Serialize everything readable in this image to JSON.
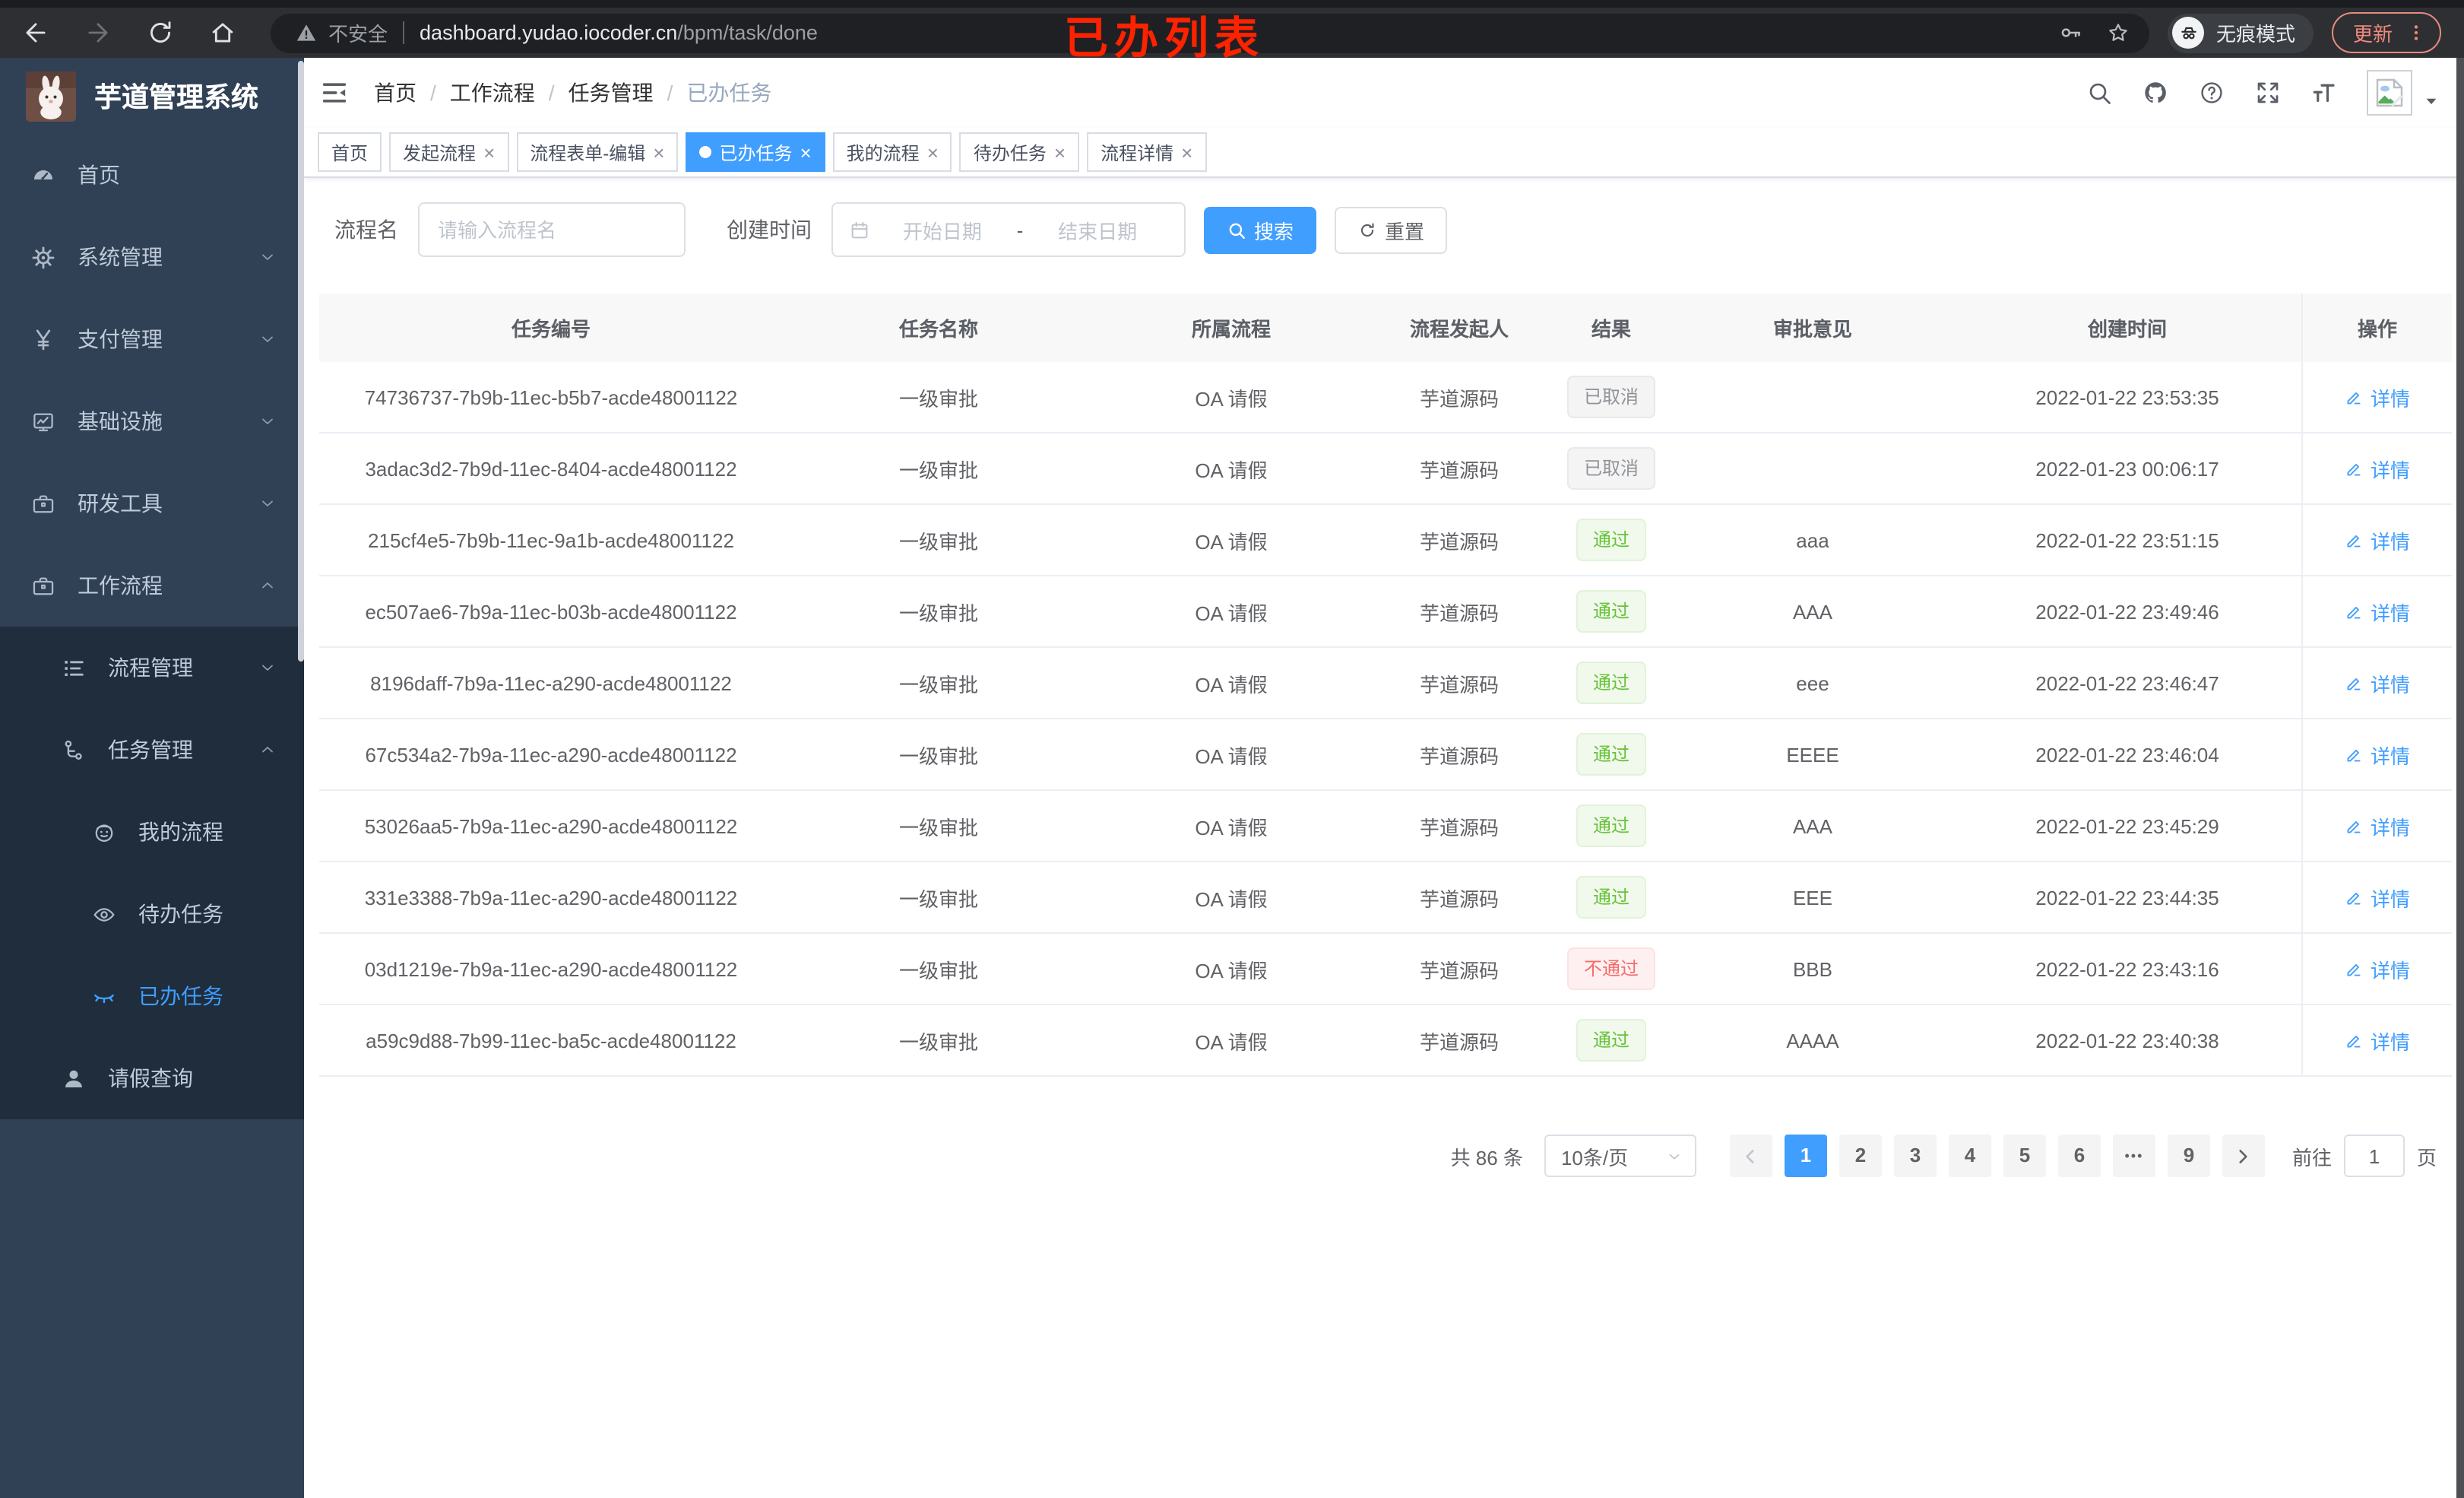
{
  "browser": {
    "nav_icons": [
      "back-icon",
      "forward-icon",
      "reload-icon",
      "home-icon"
    ],
    "security_label": "不安全",
    "url_host": "dashboard.yudao.iocoder.cn",
    "url_path": "/bpm/task/done",
    "incognito_label": "无痕模式",
    "update_label": "更新",
    "annotation": "已办列表"
  },
  "sidebar": {
    "title": "芋道管理系统",
    "items": [
      {
        "label": "首页",
        "icon": "dashboard-icon",
        "level": 1,
        "type": "item",
        "sub": false,
        "active": false
      },
      {
        "label": "系统管理",
        "icon": "gear-icon",
        "level": 1,
        "type": "group",
        "state": "collapsed",
        "sub": false,
        "active": false
      },
      {
        "label": "支付管理",
        "icon": "yen-icon",
        "level": 1,
        "type": "group",
        "state": "collapsed",
        "sub": false,
        "active": false
      },
      {
        "label": "基础设施",
        "icon": "monitor-icon",
        "level": 1,
        "type": "group",
        "state": "collapsed",
        "sub": false,
        "active": false
      },
      {
        "label": "研发工具",
        "icon": "briefcase-icon",
        "level": 1,
        "type": "group",
        "state": "collapsed",
        "sub": false,
        "active": false
      },
      {
        "label": "工作流程",
        "icon": "briefcase-icon",
        "level": 1,
        "type": "group",
        "state": "expanded",
        "sub": false,
        "active": false
      },
      {
        "label": "流程管理",
        "icon": "list-icon",
        "level": 2,
        "type": "group",
        "state": "collapsed",
        "sub": true,
        "active": false
      },
      {
        "label": "任务管理",
        "icon": "tree-icon",
        "level": 2,
        "type": "group",
        "state": "expanded",
        "sub": true,
        "active": false
      },
      {
        "label": "我的流程",
        "icon": "user-face-icon",
        "level": 3,
        "type": "item",
        "sub": true,
        "active": false
      },
      {
        "label": "待办任务",
        "icon": "eye-open-icon",
        "level": 3,
        "type": "item",
        "sub": true,
        "active": false
      },
      {
        "label": "已办任务",
        "icon": "eye-closed-icon",
        "level": 3,
        "type": "item",
        "sub": true,
        "active": true
      },
      {
        "label": "请假查询",
        "icon": "user-icon",
        "level": 2,
        "type": "item",
        "sub": true,
        "active": false
      }
    ]
  },
  "navbar": {
    "breadcrumb": [
      "首页",
      "工作流程",
      "任务管理",
      "已办任务"
    ],
    "separator": "/",
    "action_icons": [
      "search-icon",
      "github-icon",
      "question-icon",
      "fullscreen-icon",
      "font-size-icon"
    ]
  },
  "tabs": [
    {
      "label": "首页",
      "closable": false,
      "active": false
    },
    {
      "label": "发起流程",
      "closable": true,
      "active": false
    },
    {
      "label": "流程表单-编辑",
      "closable": true,
      "active": false
    },
    {
      "label": "已办任务",
      "closable": true,
      "active": true
    },
    {
      "label": "我的流程",
      "closable": true,
      "active": false
    },
    {
      "label": "待办任务",
      "closable": true,
      "active": false
    },
    {
      "label": "流程详情",
      "closable": true,
      "active": false
    }
  ],
  "filters": {
    "name_label": "流程名",
    "name_placeholder": "请输入流程名",
    "time_label": "创建时间",
    "start_placeholder": "开始日期",
    "range_separator": "-",
    "end_placeholder": "结束日期",
    "search_label": "搜索",
    "reset_label": "重置"
  },
  "table": {
    "columns": [
      {
        "key": "id",
        "label": "任务编号"
      },
      {
        "key": "name",
        "label": "任务名称"
      },
      {
        "key": "process",
        "label": "所属流程"
      },
      {
        "key": "starter",
        "label": "流程发起人"
      },
      {
        "key": "result",
        "label": "结果"
      },
      {
        "key": "comment",
        "label": "审批意见"
      },
      {
        "key": "time",
        "label": "创建时间"
      },
      {
        "key": "action",
        "label": "操作"
      }
    ],
    "action_label": "详情",
    "rows": [
      {
        "id": "74736737-7b9b-11ec-b5b7-acde48001122",
        "name": "一级审批",
        "process": "OA 请假",
        "starter": "芋道源码",
        "result": "已取消",
        "result_type": "info",
        "comment": "",
        "time": "2022-01-22 23:53:35"
      },
      {
        "id": "3adac3d2-7b9d-11ec-8404-acde48001122",
        "name": "一级审批",
        "process": "OA 请假",
        "starter": "芋道源码",
        "result": "已取消",
        "result_type": "info",
        "comment": "",
        "time": "2022-01-23 00:06:17"
      },
      {
        "id": "215cf4e5-7b9b-11ec-9a1b-acde48001122",
        "name": "一级审批",
        "process": "OA 请假",
        "starter": "芋道源码",
        "result": "通过",
        "result_type": "success",
        "comment": "aaa",
        "time": "2022-01-22 23:51:15"
      },
      {
        "id": "ec507ae6-7b9a-11ec-b03b-acde48001122",
        "name": "一级审批",
        "process": "OA 请假",
        "starter": "芋道源码",
        "result": "通过",
        "result_type": "success",
        "comment": "AAA",
        "time": "2022-01-22 23:49:46"
      },
      {
        "id": "8196daff-7b9a-11ec-a290-acde48001122",
        "name": "一级审批",
        "process": "OA 请假",
        "starter": "芋道源码",
        "result": "通过",
        "result_type": "success",
        "comment": "eee",
        "time": "2022-01-22 23:46:47"
      },
      {
        "id": "67c534a2-7b9a-11ec-a290-acde48001122",
        "name": "一级审批",
        "process": "OA 请假",
        "starter": "芋道源码",
        "result": "通过",
        "result_type": "success",
        "comment": "EEEE",
        "time": "2022-01-22 23:46:04"
      },
      {
        "id": "53026aa5-7b9a-11ec-a290-acde48001122",
        "name": "一级审批",
        "process": "OA 请假",
        "starter": "芋道源码",
        "result": "通过",
        "result_type": "success",
        "comment": "AAA",
        "time": "2022-01-22 23:45:29"
      },
      {
        "id": "331e3388-7b9a-11ec-a290-acde48001122",
        "name": "一级审批",
        "process": "OA 请假",
        "starter": "芋道源码",
        "result": "通过",
        "result_type": "success",
        "comment": "EEE",
        "time": "2022-01-22 23:44:35"
      },
      {
        "id": "03d1219e-7b9a-11ec-a290-acde48001122",
        "name": "一级审批",
        "process": "OA 请假",
        "starter": "芋道源码",
        "result": "不通过",
        "result_type": "danger",
        "comment": "BBB",
        "time": "2022-01-22 23:43:16"
      },
      {
        "id": "a59c9d88-7b99-11ec-ba5c-acde48001122",
        "name": "一级审批",
        "process": "OA 请假",
        "starter": "芋道源码",
        "result": "通过",
        "result_type": "success",
        "comment": "AAAA",
        "time": "2022-01-22 23:40:38"
      }
    ]
  },
  "pagination": {
    "total_label": "共 86 条",
    "page_size_label": "10条/页",
    "pages": [
      "1",
      "2",
      "3",
      "4",
      "5",
      "6",
      "•••",
      "9"
    ],
    "active_page": "1",
    "goto_label": "前往",
    "goto_value": "1",
    "unit_label": "页"
  },
  "colors": {
    "accent": "#409eff",
    "success": "#67c23a",
    "danger": "#f56c6c",
    "info": "#909399",
    "annotation": "#ff2200",
    "sidebar_bg": "#304156",
    "submenu_bg": "#1f2d3d"
  }
}
